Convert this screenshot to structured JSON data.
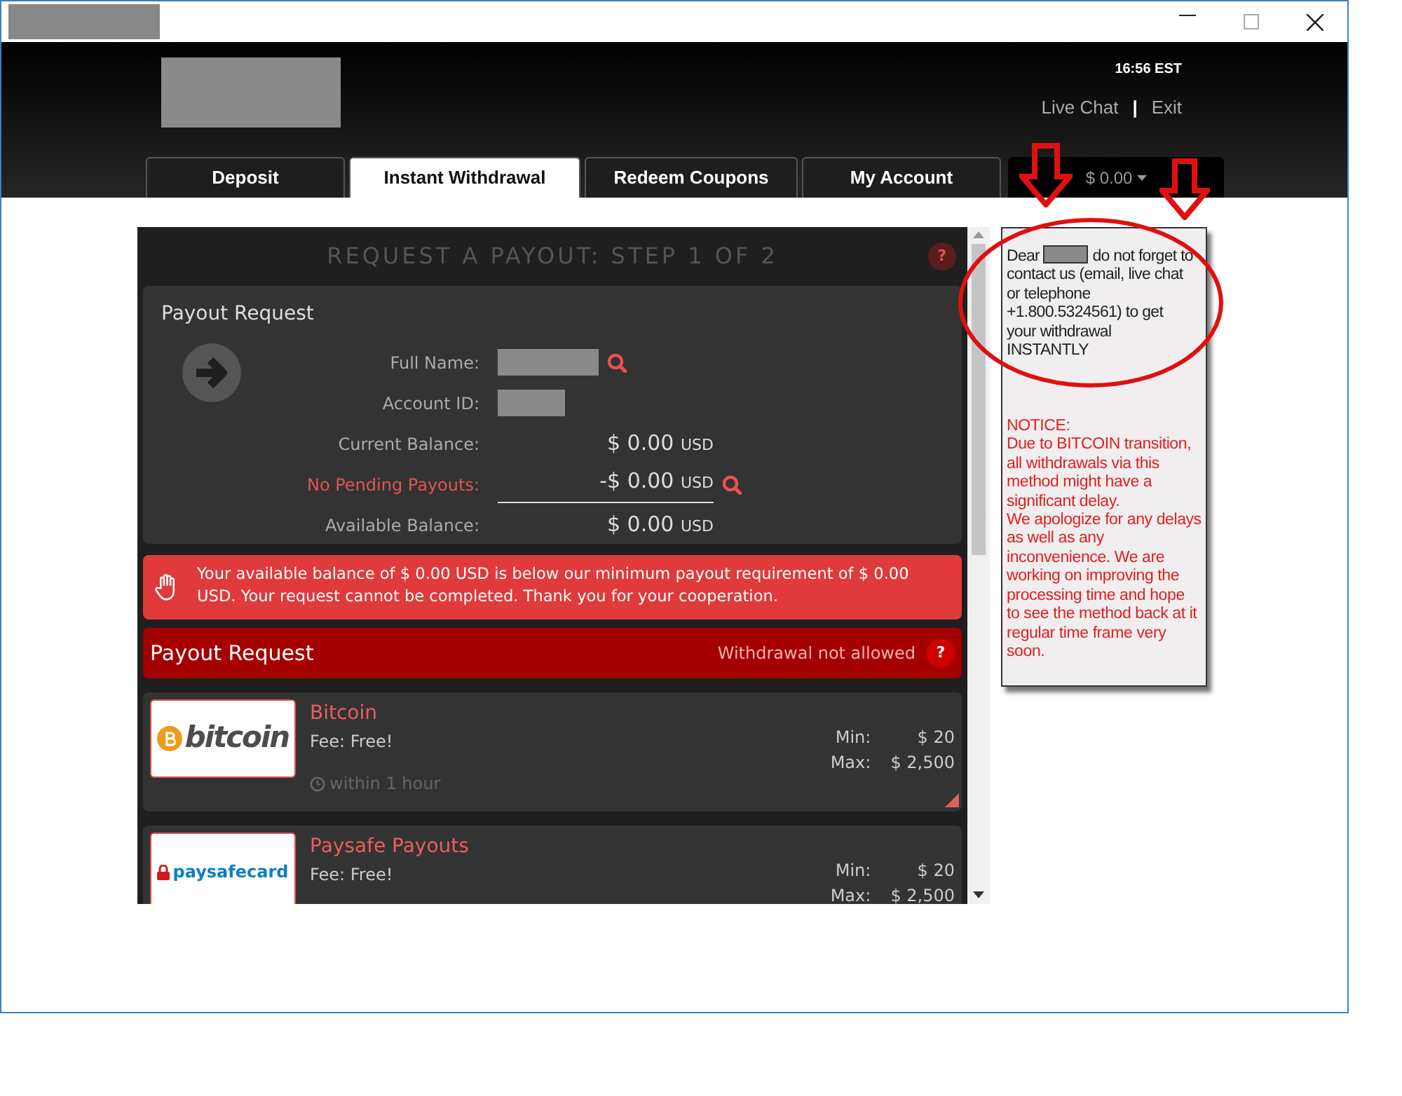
{
  "header": {
    "time": "16:56 EST",
    "links": [
      {
        "label": "Live Chat",
        "kind": "link"
      },
      {
        "label": "|",
        "kind": "separator"
      },
      {
        "label": "Exit",
        "kind": "link"
      }
    ]
  },
  "tabs": [
    {
      "label": "Deposit",
      "selected": false
    },
    {
      "label": "Instant Withdrawal",
      "selected": true
    },
    {
      "label": "Redeem Coupons",
      "selected": false
    },
    {
      "label": "My Account",
      "selected": false
    }
  ],
  "balance_tab": {
    "label": "$ 0.00"
  },
  "panel": {
    "title": "REQUEST A PAYOUT: STEP 1 OF 2",
    "help": "?",
    "summary": {
      "heading": "Payout Request",
      "fields": [
        {
          "label": "Full Name:"
        },
        {
          "label": "Account ID:"
        }
      ],
      "balances": [
        {
          "label": "Current Balance:",
          "amount": "$ 0.00",
          "unit": "USD",
          "kind": "normal"
        },
        {
          "label": "No Pending Payouts:",
          "amount": "-$ 0.00",
          "unit": "USD",
          "kind": "pending"
        },
        {
          "label": "Available Balance:",
          "amount": "$ 0.00",
          "unit": "USD",
          "kind": "normal"
        }
      ]
    },
    "alert": "Your available balance of $ 0.00 USD is below our minimum payout requirement of $ 0.00 USD. Your request cannot be completed. Thank you for your cooperation.",
    "payout_bar": {
      "title": "Payout Request",
      "status": "Withdrawal not allowed",
      "help": "?"
    },
    "methods": [
      {
        "logo": "bitcoin",
        "kind": "bitcoin",
        "name": "Bitcoin",
        "fee": "Fee: Free!",
        "time": "within 1 hour",
        "min_label": "Min:",
        "min": "$ 20",
        "max_label": "Max:",
        "max": "$ 2,500"
      },
      {
        "logo": "paysafecard",
        "kind": "paysafe",
        "name": "Paysafe Payouts",
        "fee": "Fee: Free!",
        "min_label": "Min:",
        "min": "$ 20",
        "max_label": "Max:",
        "max": "$ 2,500"
      }
    ]
  },
  "notice": {
    "contact": [
      {
        "kind": "text",
        "text": "Dear "
      },
      {
        "kind": "redacted"
      },
      {
        "kind": "text",
        "text": " do not forget to contact us ("
      },
      {
        "kind": "link",
        "text": "email"
      },
      {
        "kind": "text",
        "text": ", "
      },
      {
        "kind": "link",
        "text": "live chat"
      },
      {
        "kind": "text",
        "text": " or telephone +1.800.5324561) to get your withdrawal INSTANTLY"
      }
    ],
    "warning": [
      "NOTICE:",
      "Due to BITCOIN transition, all withdrawals via this method might have a significant delay.",
      "We apologize for any delays as well as any inconvenience. We are working on improving the processing time and hope to see the method back at it regular time frame very soon."
    ]
  }
}
